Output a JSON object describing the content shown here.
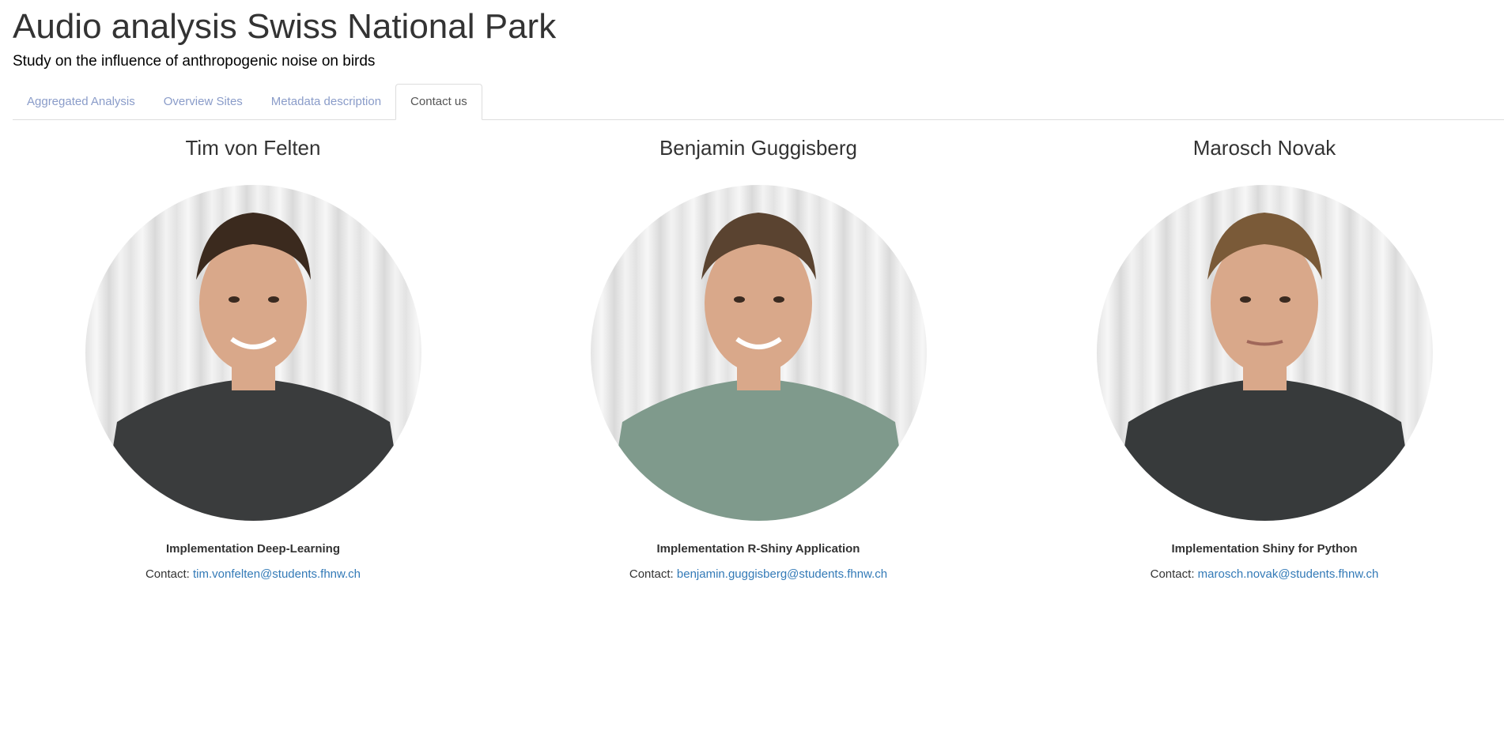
{
  "header": {
    "title": "Audio analysis Swiss National Park",
    "subtitle": "Study on the influence of anthropogenic noise on birds"
  },
  "tabs": [
    {
      "label": "Aggregated Analysis",
      "active": false
    },
    {
      "label": "Overview Sites",
      "active": false
    },
    {
      "label": "Metadata description",
      "active": false
    },
    {
      "label": "Contact us",
      "active": true
    }
  ],
  "team": [
    {
      "name": "Tim von Felten",
      "role": "Implementation Deep-Learning",
      "contact_label": "Contact:",
      "email": "tim.vonfelten@students.fhnw.ch",
      "shirt_color": "#3a3c3d",
      "hair_color": "#3b2a1e"
    },
    {
      "name": "Benjamin Guggisberg",
      "role": "Implementation R-Shiny Application",
      "contact_label": "Contact:",
      "email": "benjamin.guggisberg@students.fhnw.ch",
      "shirt_color": "#7f9a8c",
      "hair_color": "#5a4330"
    },
    {
      "name": "Marosch Novak",
      "role": "Implementation Shiny for Python",
      "contact_label": "Contact:",
      "email": "marosch.novak@students.fhnw.ch",
      "shirt_color": "#373a3b",
      "hair_color": "#7a5a38"
    }
  ],
  "colors": {
    "link": "#337ab7",
    "tab_inactive": "#8a9cc9",
    "skin": "#d9a88a"
  }
}
